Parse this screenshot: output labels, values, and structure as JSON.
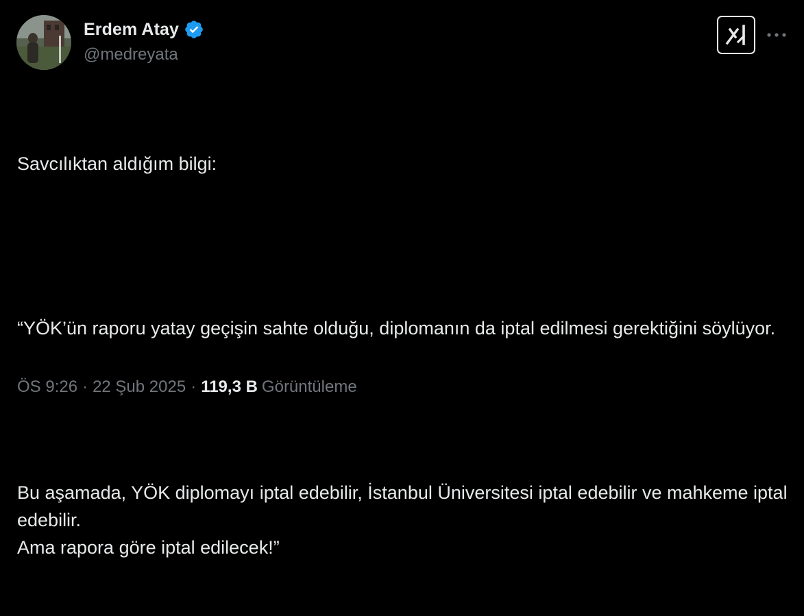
{
  "author": {
    "display_name": "Erdem Atay",
    "handle": "@medreyata",
    "verified_icon": "verified-badge-icon",
    "verified_color": "#1d9bf0",
    "avatar_icon": "avatar-photo"
  },
  "actions": {
    "grok_icon": "grok-logo-icon",
    "more_icon": "more-dots-icon"
  },
  "tweet": {
    "paragraphs": [
      "Savcılıktan aldığım bilgi:",
      "“YÖK’ün raporu yatay geçişin sahte olduğu, diplomanın da iptal edilmesi gerektiğini söylüyor.",
      "Bu aşamada, YÖK diplomayı iptal edebilir, İstanbul Üniversitesi iptal edebilir ve mahkeme iptal edebilir.\nAma rapora göre iptal edilecek!”"
    ]
  },
  "meta": {
    "time": "ÖS 9:26",
    "separator": "·",
    "date": "22 Şub 2025",
    "views_count": "119,3 B",
    "views_label": "Görüntüleme"
  },
  "colors": {
    "background": "#000000",
    "text_primary": "#e7e9ea",
    "text_secondary": "#71767b",
    "accent": "#1d9bf0"
  }
}
